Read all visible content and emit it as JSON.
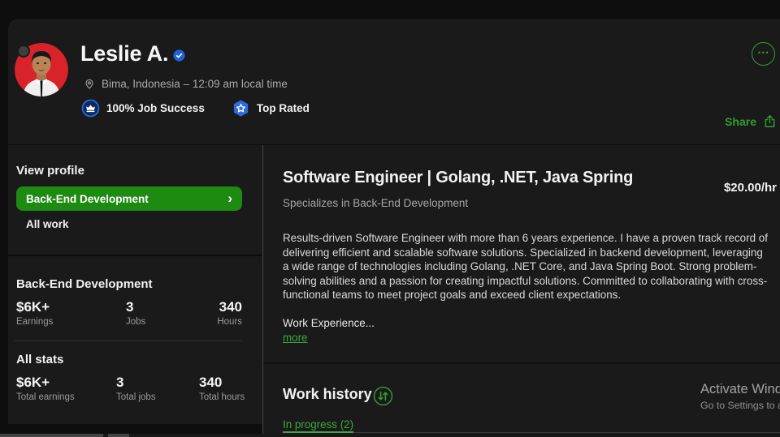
{
  "header": {
    "name": "Leslie A.",
    "location": "Bima, Indonesia – 12:09 am local time",
    "job_success_badge": "100% Job Success",
    "top_rated_badge": "Top Rated",
    "share_label": "Share"
  },
  "sidebar": {
    "view_profile_title": "View profile",
    "specialization_button_label": "Back-End Development",
    "all_work_label": "All work",
    "specialized_stats": {
      "title": "Back-End Development",
      "stats": [
        {
          "value": "$6K+",
          "label": "Earnings"
        },
        {
          "value": "3",
          "label": "Jobs"
        },
        {
          "value": "340",
          "label": "Hours"
        }
      ]
    },
    "all_stats": {
      "title": "All stats",
      "stats": [
        {
          "value": "$6K+",
          "label": "Total earnings"
        },
        {
          "value": "3",
          "label": "Total jobs"
        },
        {
          "value": "340",
          "label": "Total hours"
        }
      ]
    }
  },
  "main": {
    "title": "Software Engineer | Golang, .NET, Java Spring",
    "hourly_rate": "$20.00/hr",
    "subtitle": "Specializes in Back-End Development",
    "description": "Results-driven Software Engineer with more than 6 years experience. I have a proven track record of delivering efficient and scalable software solutions. Specialized in backend development, leveraging a wide range of technologies including Golang, .NET Core, and Java Spring Boot. Strong problem-solving abilities and a passion for creating impactful solutions. Committed to collaborating with cross-functional teams to meet project goals and exceed client expectations.",
    "work_experience_label": "Work Experience...",
    "more_link_label": "more",
    "work_history_title": "Work history",
    "in_progress_tab_label": "In progress (2)"
  },
  "watermark": {
    "line1": "Activate Windows",
    "line2": "Go to Settings to activate Windows."
  },
  "icons": {
    "chevron_right": "›",
    "more_options_dots": "•••"
  },
  "colors": {
    "page_background": "#0e0e0e",
    "card_background": "#1a1a1a",
    "accent_green": "#2f9e33",
    "button_green": "#1d8a12",
    "link_green": "#3da73f",
    "badge_blue": "#2e6bdf",
    "avatar_red": "#d8232a"
  }
}
